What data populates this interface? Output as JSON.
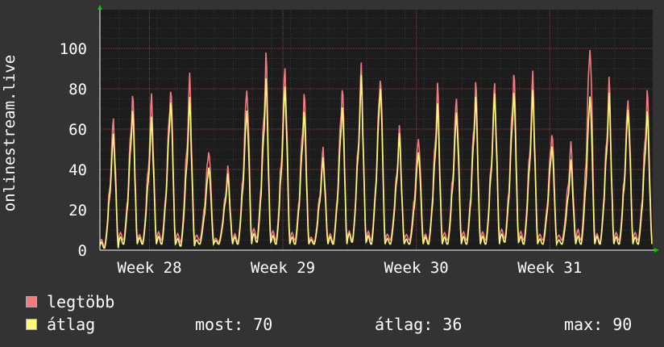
{
  "chart_data": {
    "type": "line",
    "ylabel": "onlinestream.live",
    "ylim": [
      0,
      120
    ],
    "yticks": [
      0,
      20,
      40,
      60,
      80,
      100
    ],
    "xticks": [
      "Week 28",
      "Week 29",
      "Week 30",
      "Week 31"
    ],
    "grid": true,
    "days": 29,
    "series": [
      {
        "name": "legtöbb",
        "color": "#f57a7f",
        "daily_peaks": [
          68,
          80,
          78,
          85,
          88,
          53,
          42,
          86,
          98,
          95,
          80,
          52,
          85,
          93,
          92,
          62,
          60,
          83,
          80,
          85,
          85,
          92,
          89,
          62,
          54,
          109,
          86,
          80,
          80
        ],
        "daily_troughs": [
          2,
          5,
          4,
          5,
          4,
          5,
          4,
          4,
          6,
          5,
          5,
          4,
          4,
          5,
          5,
          5,
          5,
          4,
          5,
          5,
          5,
          6,
          5,
          5,
          5,
          5,
          4,
          5,
          5
        ]
      },
      {
        "name": "átlag",
        "color": "#fff97a",
        "daily_peaks": [
          60,
          72,
          67,
          78,
          76,
          44,
          38,
          74,
          86,
          85,
          71,
          47,
          75,
          87,
          86,
          58,
          52,
          73,
          72,
          78,
          80,
          82,
          80,
          55,
          45,
          82,
          78,
          74,
          70
        ],
        "daily_troughs": [
          1,
          3,
          3,
          3,
          2,
          3,
          3,
          3,
          4,
          3,
          3,
          3,
          3,
          4,
          3,
          3,
          3,
          3,
          3,
          3,
          3,
          4,
          3,
          3,
          3,
          3,
          3,
          3,
          3
        ]
      }
    ]
  },
  "legend": {
    "max_label": "legtöbb",
    "avg_label": "átlag",
    "stats": {
      "now": "most: 70",
      "avg": "átlag: 36",
      "max": "max: 90"
    }
  }
}
